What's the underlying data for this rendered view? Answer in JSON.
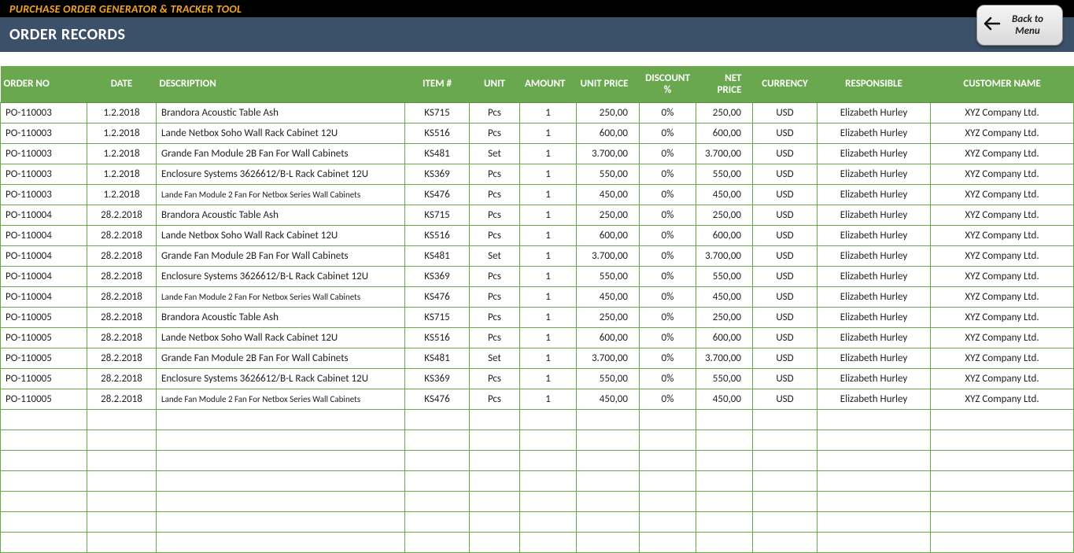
{
  "topbar": {
    "title": "PURCHASE ORDER GENERATOR & TRACKER TOOL"
  },
  "subbar": {
    "title": "ORDER RECORDS"
  },
  "menu_button": {
    "line1": "Back to",
    "line2": "Menu"
  },
  "table": {
    "headers": {
      "order_no": "ORDER NO",
      "date": "DATE",
      "description": "DESCRIPTION",
      "item": "ITEM #",
      "unit": "UNIT",
      "amount": "AMOUNT",
      "unit_price": "UNIT PRICE",
      "discount": "DISCOUNT %",
      "net_price": "NET PRICE",
      "currency": "CURRENCY",
      "responsible": "RESPONSIBLE",
      "customer": "CUSTOMER NAME"
    },
    "rows": [
      {
        "order_no": "PO-110003",
        "date": "1.2.2018",
        "description": "Brandora Acoustic Table Ash",
        "item": "KS715",
        "unit": "Pcs",
        "amount": "1",
        "unit_price": "250,00",
        "discount": "0%",
        "net_price": "250,00",
        "currency": "USD",
        "responsible": "Elizabeth Hurley",
        "customer": "XYZ Company Ltd.",
        "small": false
      },
      {
        "order_no": "PO-110003",
        "date": "1.2.2018",
        "description": "Lande Netbox Soho Wall Rack Cabinet 12U",
        "item": "KS516",
        "unit": "Pcs",
        "amount": "1",
        "unit_price": "600,00",
        "discount": "0%",
        "net_price": "600,00",
        "currency": "USD",
        "responsible": "Elizabeth Hurley",
        "customer": "XYZ Company Ltd.",
        "small": false
      },
      {
        "order_no": "PO-110003",
        "date": "1.2.2018",
        "description": "Grande Fan Module 2B Fan For Wall Cabinets",
        "item": "KS481",
        "unit": "Set",
        "amount": "1",
        "unit_price": "3.700,00",
        "discount": "0%",
        "net_price": "3.700,00",
        "currency": "USD",
        "responsible": "Elizabeth Hurley",
        "customer": "XYZ Company Ltd.",
        "small": false
      },
      {
        "order_no": "PO-110003",
        "date": "1.2.2018",
        "description": "Enclosure Systems 3626612/B-L Rack Cabinet 12U",
        "item": "KS369",
        "unit": "Pcs",
        "amount": "1",
        "unit_price": "550,00",
        "discount": "0%",
        "net_price": "550,00",
        "currency": "USD",
        "responsible": "Elizabeth Hurley",
        "customer": "XYZ Company Ltd.",
        "small": false
      },
      {
        "order_no": "PO-110003",
        "date": "1.2.2018",
        "description": "Lande Fan Module 2 Fan For Netbox Series Wall Cabinets",
        "item": "KS476",
        "unit": "Pcs",
        "amount": "1",
        "unit_price": "450,00",
        "discount": "0%",
        "net_price": "450,00",
        "currency": "USD",
        "responsible": "Elizabeth Hurley",
        "customer": "XYZ Company Ltd.",
        "small": true
      },
      {
        "order_no": "PO-110004",
        "date": "28.2.2018",
        "description": "Brandora Acoustic Table Ash",
        "item": "KS715",
        "unit": "Pcs",
        "amount": "1",
        "unit_price": "250,00",
        "discount": "0%",
        "net_price": "250,00",
        "currency": "USD",
        "responsible": "Elizabeth Hurley",
        "customer": "XYZ Company Ltd.",
        "small": false
      },
      {
        "order_no": "PO-110004",
        "date": "28.2.2018",
        "description": "Lande Netbox Soho Wall Rack Cabinet 12U",
        "item": "KS516",
        "unit": "Pcs",
        "amount": "1",
        "unit_price": "600,00",
        "discount": "0%",
        "net_price": "600,00",
        "currency": "USD",
        "responsible": "Elizabeth Hurley",
        "customer": "XYZ Company Ltd.",
        "small": false
      },
      {
        "order_no": "PO-110004",
        "date": "28.2.2018",
        "description": "Grande Fan Module 2B Fan For Wall Cabinets",
        "item": "KS481",
        "unit": "Set",
        "amount": "1",
        "unit_price": "3.700,00",
        "discount": "0%",
        "net_price": "3.700,00",
        "currency": "USD",
        "responsible": "Elizabeth Hurley",
        "customer": "XYZ Company Ltd.",
        "small": false
      },
      {
        "order_no": "PO-110004",
        "date": "28.2.2018",
        "description": "Enclosure Systems 3626612/B-L Rack Cabinet 12U",
        "item": "KS369",
        "unit": "Pcs",
        "amount": "1",
        "unit_price": "550,00",
        "discount": "0%",
        "net_price": "550,00",
        "currency": "USD",
        "responsible": "Elizabeth Hurley",
        "customer": "XYZ Company Ltd.",
        "small": false
      },
      {
        "order_no": "PO-110004",
        "date": "28.2.2018",
        "description": "Lande Fan Module 2 Fan For Netbox Series Wall Cabinets",
        "item": "KS476",
        "unit": "Pcs",
        "amount": "1",
        "unit_price": "450,00",
        "discount": "0%",
        "net_price": "450,00",
        "currency": "USD",
        "responsible": "Elizabeth Hurley",
        "customer": "XYZ Company Ltd.",
        "small": true
      },
      {
        "order_no": "PO-110005",
        "date": "28.2.2018",
        "description": "Brandora Acoustic Table Ash",
        "item": "KS715",
        "unit": "Pcs",
        "amount": "1",
        "unit_price": "250,00",
        "discount": "0%",
        "net_price": "250,00",
        "currency": "USD",
        "responsible": "Elizabeth Hurley",
        "customer": "XYZ Company Ltd.",
        "small": false
      },
      {
        "order_no": "PO-110005",
        "date": "28.2.2018",
        "description": "Lande Netbox Soho Wall Rack Cabinet 12U",
        "item": "KS516",
        "unit": "Pcs",
        "amount": "1",
        "unit_price": "600,00",
        "discount": "0%",
        "net_price": "600,00",
        "currency": "USD",
        "responsible": "Elizabeth Hurley",
        "customer": "XYZ Company Ltd.",
        "small": false
      },
      {
        "order_no": "PO-110005",
        "date": "28.2.2018",
        "description": "Grande Fan Module 2B Fan For Wall Cabinets",
        "item": "KS481",
        "unit": "Set",
        "amount": "1",
        "unit_price": "3.700,00",
        "discount": "0%",
        "net_price": "3.700,00",
        "currency": "USD",
        "responsible": "Elizabeth Hurley",
        "customer": "XYZ Company Ltd.",
        "small": false
      },
      {
        "order_no": "PO-110005",
        "date": "28.2.2018",
        "description": "Enclosure Systems 3626612/B-L Rack Cabinet 12U",
        "item": "KS369",
        "unit": "Pcs",
        "amount": "1",
        "unit_price": "550,00",
        "discount": "0%",
        "net_price": "550,00",
        "currency": "USD",
        "responsible": "Elizabeth Hurley",
        "customer": "XYZ Company Ltd.",
        "small": false
      },
      {
        "order_no": "PO-110005",
        "date": "28.2.2018",
        "description": "Lande Fan Module 2 Fan For Netbox Series Wall Cabinets",
        "item": "KS476",
        "unit": "Pcs",
        "amount": "1",
        "unit_price": "450,00",
        "discount": "0%",
        "net_price": "450,00",
        "currency": "USD",
        "responsible": "Elizabeth Hurley",
        "customer": "XYZ Company Ltd.",
        "small": true
      }
    ],
    "empty_rows": 7
  }
}
